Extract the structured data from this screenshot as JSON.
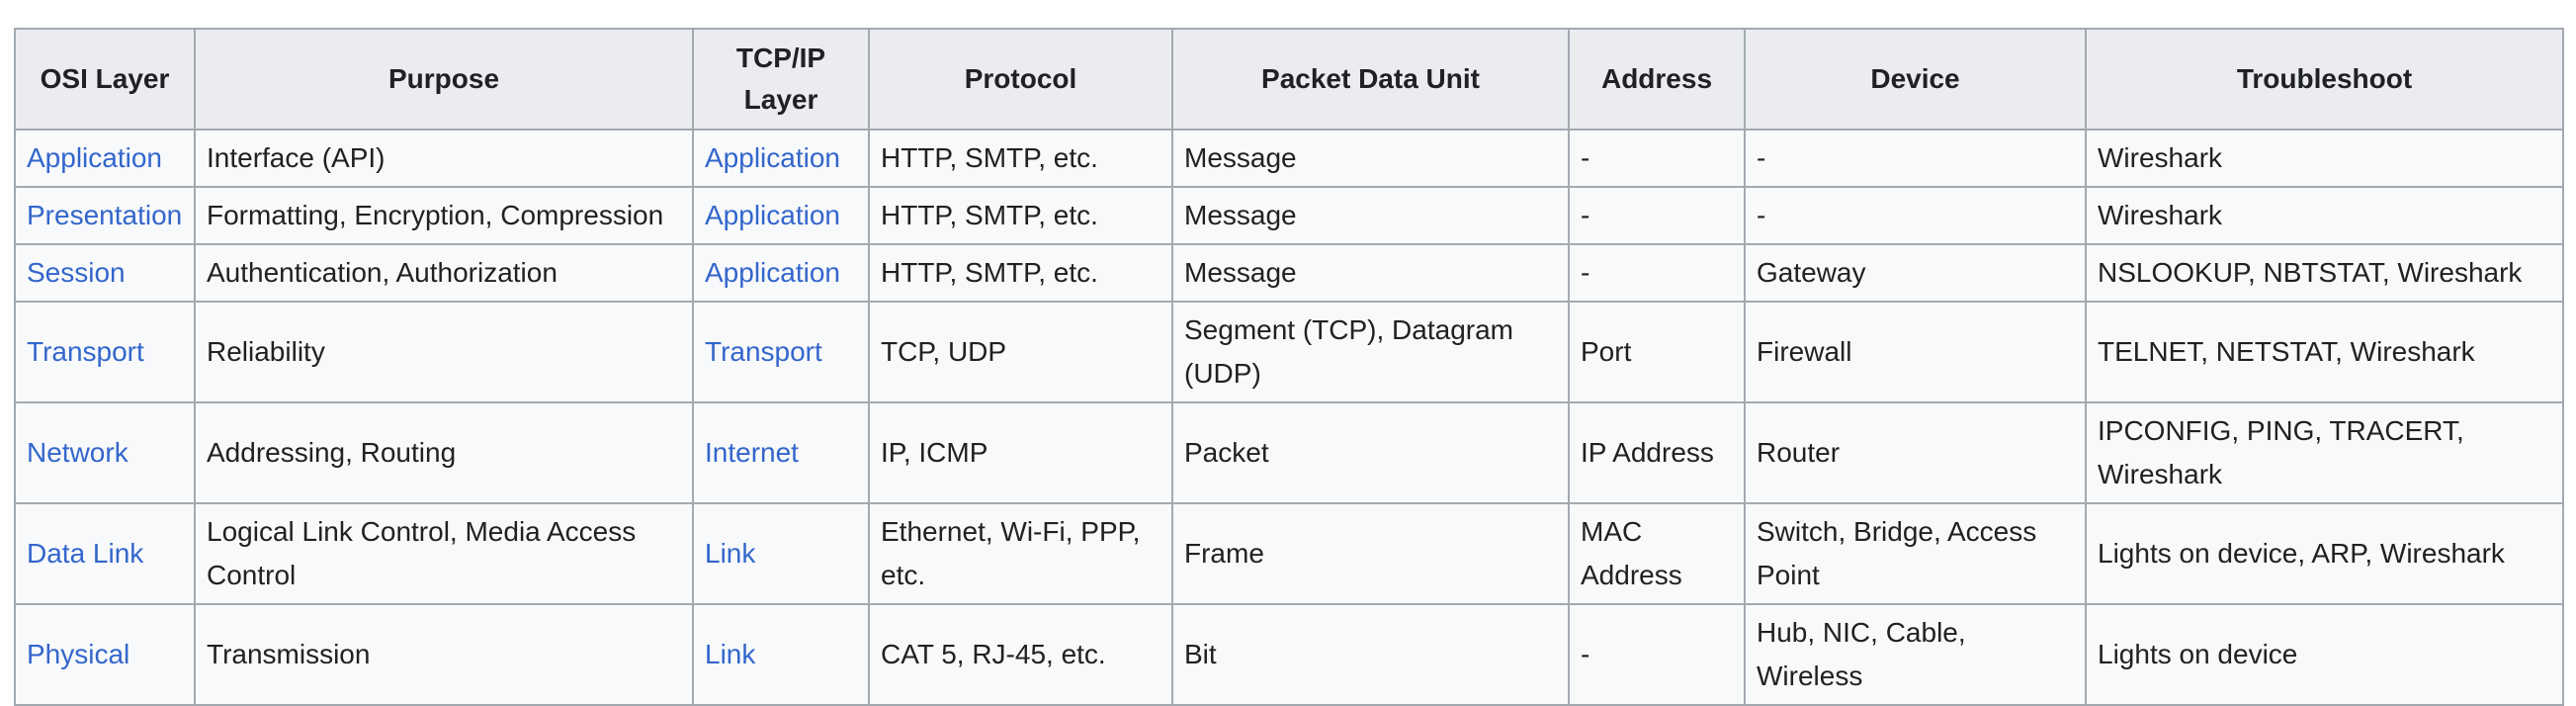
{
  "table": {
    "headers": [
      {
        "key": "osi",
        "label": "OSI Layer"
      },
      {
        "key": "purpose",
        "label": "Purpose"
      },
      {
        "key": "tcpip",
        "label": "TCP/IP Layer"
      },
      {
        "key": "protocol",
        "label": "Protocol"
      },
      {
        "key": "pdu",
        "label": "Packet Data Unit"
      },
      {
        "key": "address",
        "label": "Address"
      },
      {
        "key": "device",
        "label": "Device"
      },
      {
        "key": "troubleshoot",
        "label": "Troubleshoot"
      }
    ],
    "rows": [
      {
        "osi": "Application",
        "purpose": "Interface (API)",
        "tcpip": "Application",
        "protocol": "HTTP, SMTP, etc.",
        "pdu": "Message",
        "address": "-",
        "device": "-",
        "troubleshoot": "Wireshark"
      },
      {
        "osi": "Presentation",
        "purpose": "Formatting, Encryption, Compression",
        "tcpip": "Application",
        "protocol": "HTTP, SMTP, etc.",
        "pdu": "Message",
        "address": "-",
        "device": "-",
        "troubleshoot": "Wireshark"
      },
      {
        "osi": "Session",
        "purpose": "Authentication, Authorization",
        "tcpip": "Application",
        "protocol": "HTTP, SMTP, etc.",
        "pdu": "Message",
        "address": "-",
        "device": "Gateway",
        "troubleshoot": "NSLOOKUP, NBTSTAT, Wireshark"
      },
      {
        "osi": "Transport",
        "purpose": "Reliability",
        "tcpip": "Transport",
        "protocol": "TCP, UDP",
        "pdu": "Segment (TCP), Datagram (UDP)",
        "address": "Port",
        "device": "Firewall",
        "troubleshoot": "TELNET, NETSTAT, Wireshark"
      },
      {
        "osi": "Network",
        "purpose": "Addressing, Routing",
        "tcpip": "Internet",
        "protocol": "IP, ICMP",
        "pdu": "Packet",
        "address": "IP Address",
        "device": "Router",
        "troubleshoot": "IPCONFIG, PING, TRACERT, Wireshark"
      },
      {
        "osi": "Data Link",
        "purpose": "Logical Link Control, Media Access Control",
        "tcpip": "Link",
        "protocol": "Ethernet, Wi-Fi, PPP, etc.",
        "pdu": "Frame",
        "address": "MAC Address",
        "device": "Switch, Bridge, Access Point",
        "troubleshoot": "Lights on device, ARP, Wireshark"
      },
      {
        "osi": "Physical",
        "purpose": "Transmission",
        "tcpip": "Link",
        "protocol": "CAT 5, RJ-45, etc.",
        "pdu": "Bit",
        "address": "-",
        "device": "Hub, NIC, Cable, Wireless",
        "troubleshoot": "Lights on device"
      }
    ]
  },
  "colors": {
    "link": "#3366cc",
    "header_bg": "#eaecf0",
    "cell_bg": "#f8f9fa",
    "border": "#a2a9b1",
    "text": "#202122"
  }
}
